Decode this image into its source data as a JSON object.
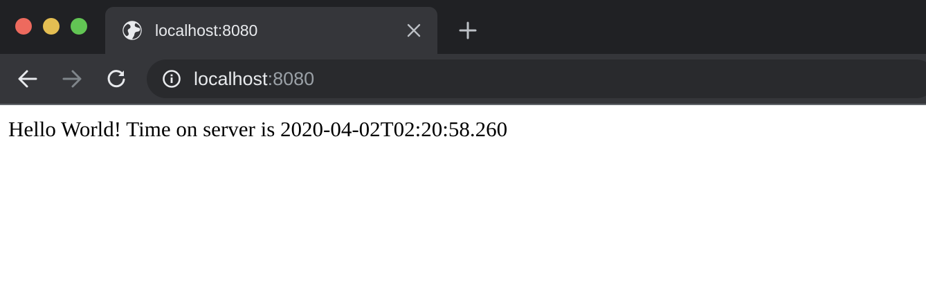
{
  "browser": {
    "colors": {
      "tabstrip_bg": "#202124",
      "active_tab_bg": "#35363a",
      "omnibox_bg": "#292a2d",
      "traffic_close": "#ed6a5e",
      "traffic_minimize": "#e4be52",
      "traffic_maximize": "#62c554"
    },
    "tabs": [
      {
        "title": "localhost:8080",
        "favicon": "globe-icon",
        "active": true
      }
    ],
    "toolbar": {
      "back_icon": "arrow-left-icon",
      "forward_icon": "arrow-right-icon",
      "forward_enabled": false,
      "reload_icon": "reload-icon"
    },
    "omnibox": {
      "security_icon": "info-icon",
      "url_host": "localhost",
      "url_port": ":8080"
    }
  },
  "page": {
    "body_text": "Hello World! Time on server is 2020-04-02T02:20:58.260"
  }
}
